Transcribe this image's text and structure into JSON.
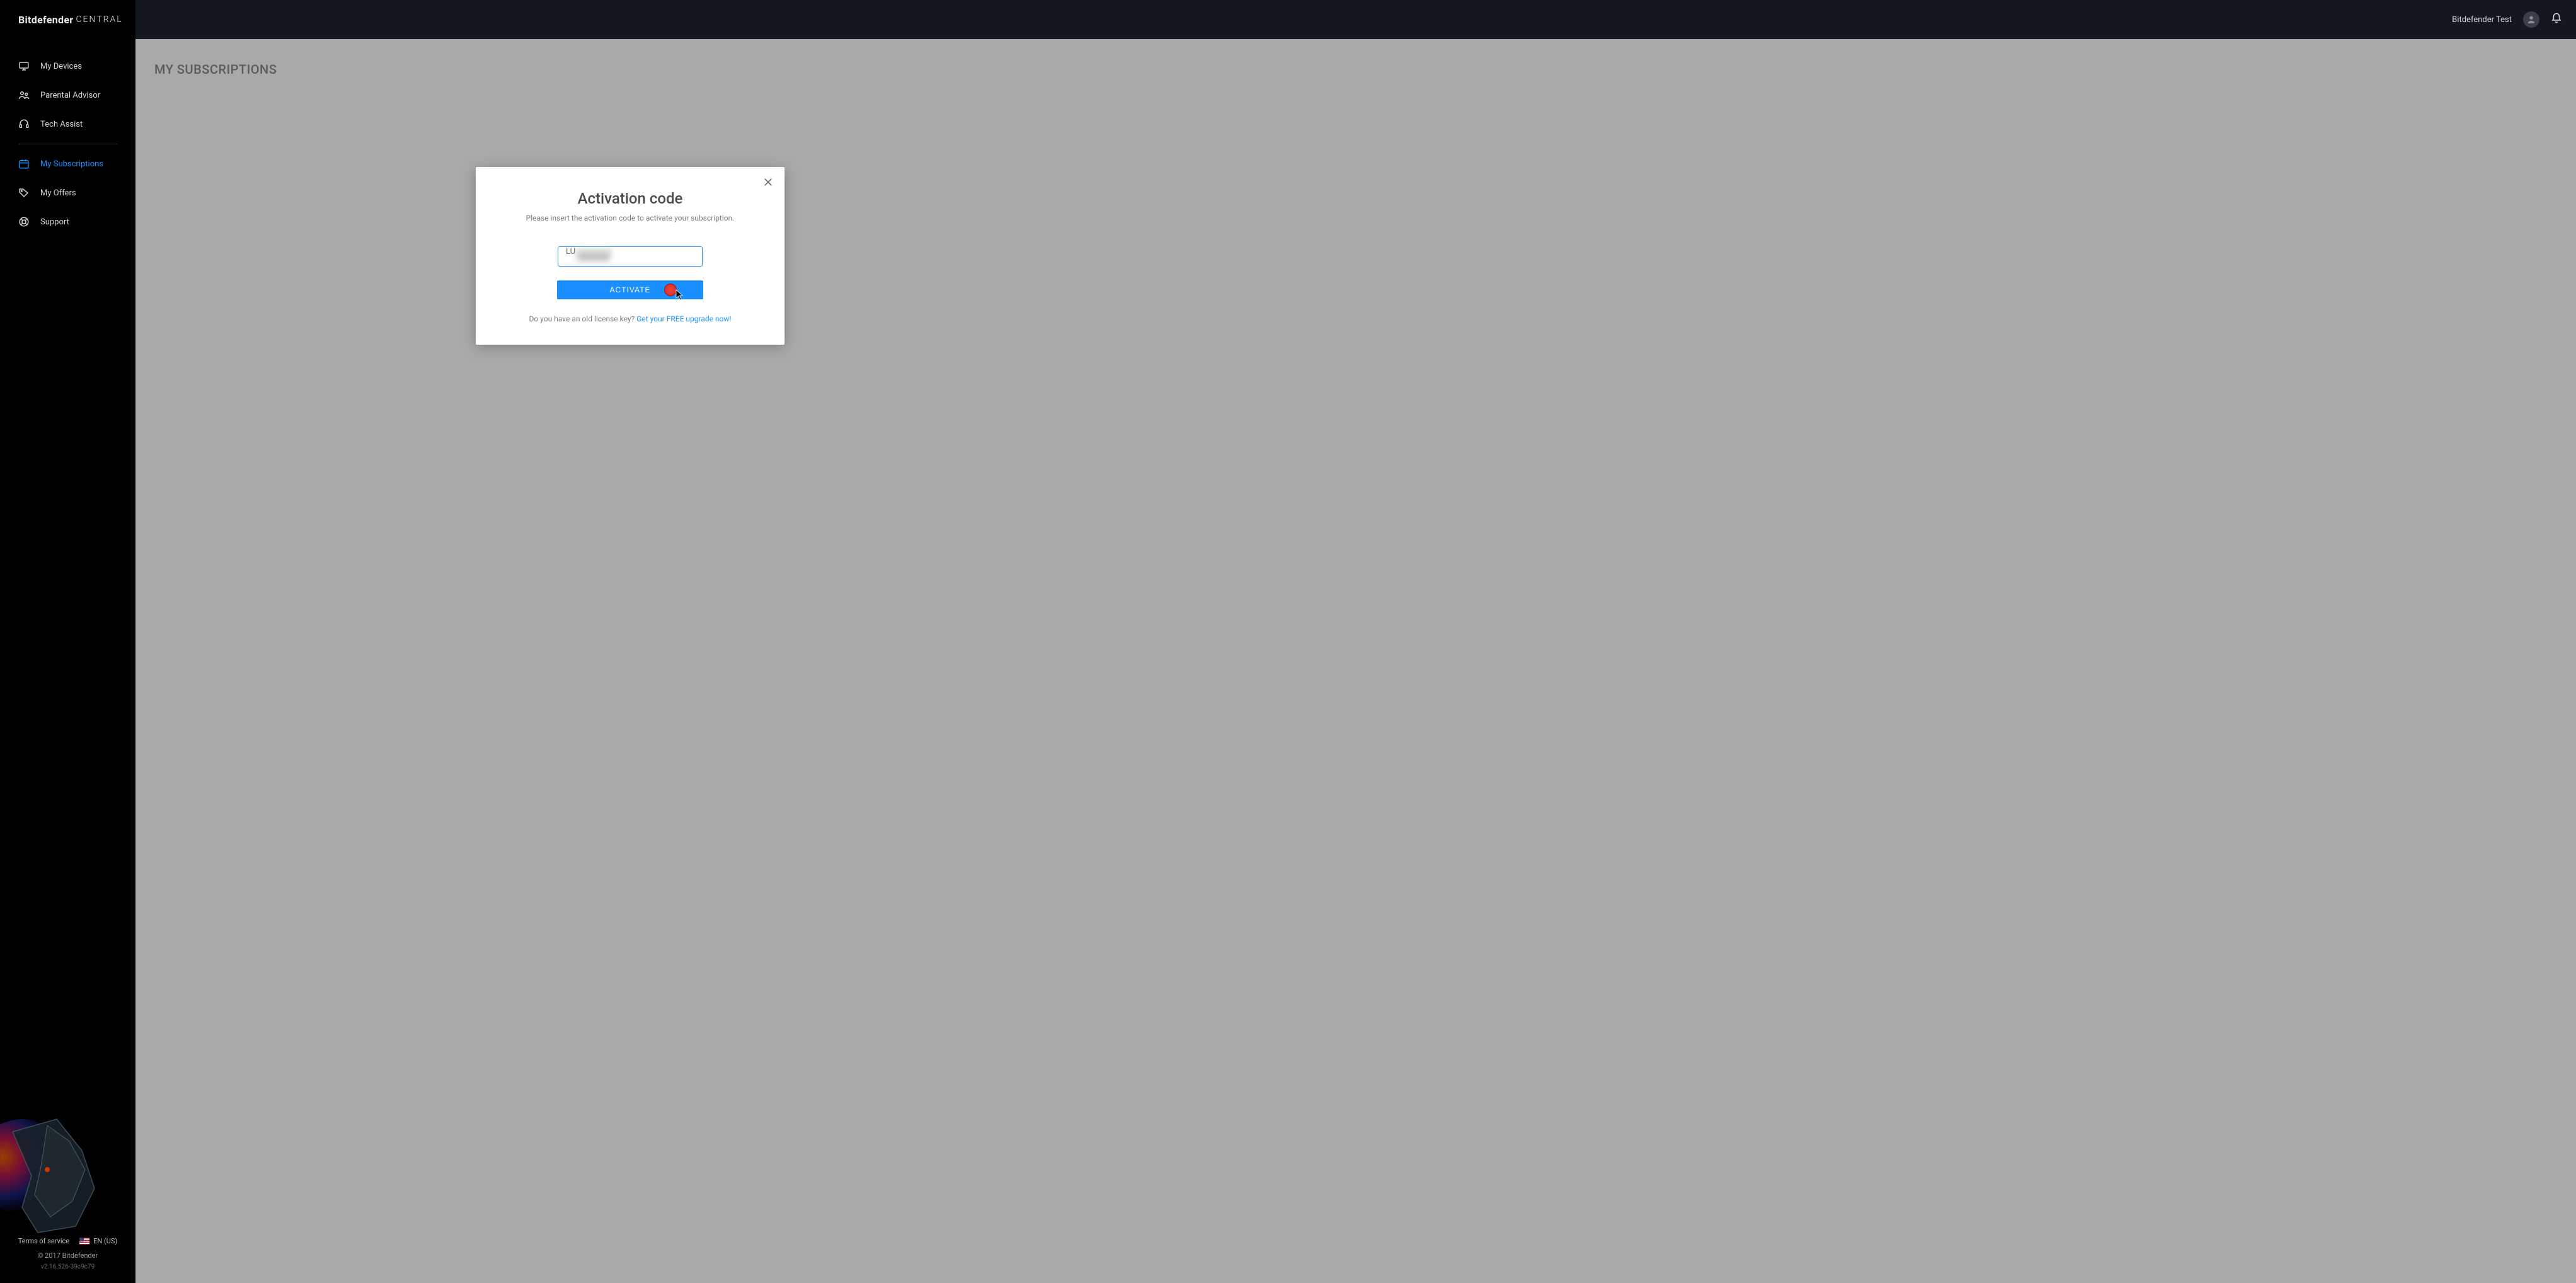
{
  "brand": {
    "name": "Bitdefender",
    "suffix": "CENTRAL"
  },
  "sidebar": {
    "items": [
      {
        "label": "My Devices"
      },
      {
        "label": "Parental Advisor"
      },
      {
        "label": "Tech Assist"
      },
      {
        "label": "My Subscriptions"
      },
      {
        "label": "My Offers"
      },
      {
        "label": "Support"
      }
    ]
  },
  "footer": {
    "tos": "Terms of service",
    "lang": "EN (US)",
    "copyright": "© 2017 Bitdefender",
    "version": "v2.16.526-39c9c79"
  },
  "header": {
    "user": "Bitdefender Test"
  },
  "page": {
    "title": "MY SUBSCRIPTIONS"
  },
  "modal": {
    "title": "Activation code",
    "subtitle": "Please insert the activation code to activate your subscription.",
    "input_value": "LU",
    "activate_label": "ACTIVATE",
    "old_key_text": "Do you have an old license key? ",
    "upgrade_link": "Get your FREE upgrade now!"
  },
  "colors": {
    "accent": "#1a8fff"
  }
}
